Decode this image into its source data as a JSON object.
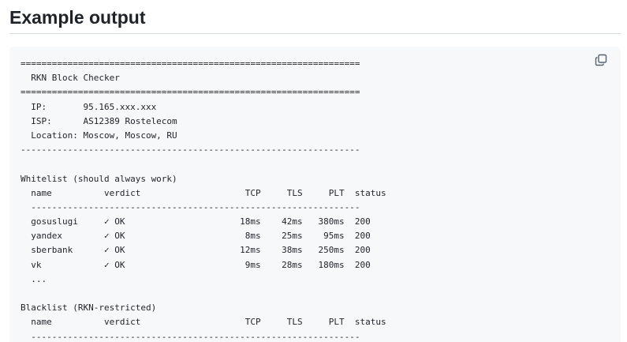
{
  "heading": "Example output",
  "copy_icon": "copy-icon",
  "code_lines": [
    "=================================================================",
    "  RKN Block Checker",
    "=================================================================",
    "  IP:       95.165.xxx.xxx",
    "  ISP:      AS12389 Rostelecom",
    "  Location: Moscow, Moscow, RU",
    "-----------------------------------------------------------------",
    "",
    "Whitelist (should always work)",
    "  name          verdict                    TCP     TLS     PLT  status",
    "  ---------------------------------------------------------------",
    "  gosuslugi     ✓ OK                      18ms    42ms   380ms  200",
    "  yandex        ✓ OK                       8ms    25ms    95ms  200",
    "  sberbank      ✓ OK                      12ms    38ms   250ms  200",
    "  vk            ✓ OK                       9ms    28ms   180ms  200",
    "  ...",
    "",
    "Blacklist (RKN-restricted)",
    "  name          verdict                    TCP     TLS     PLT  status",
    "  ---------------------------------------------------------------"
  ]
}
